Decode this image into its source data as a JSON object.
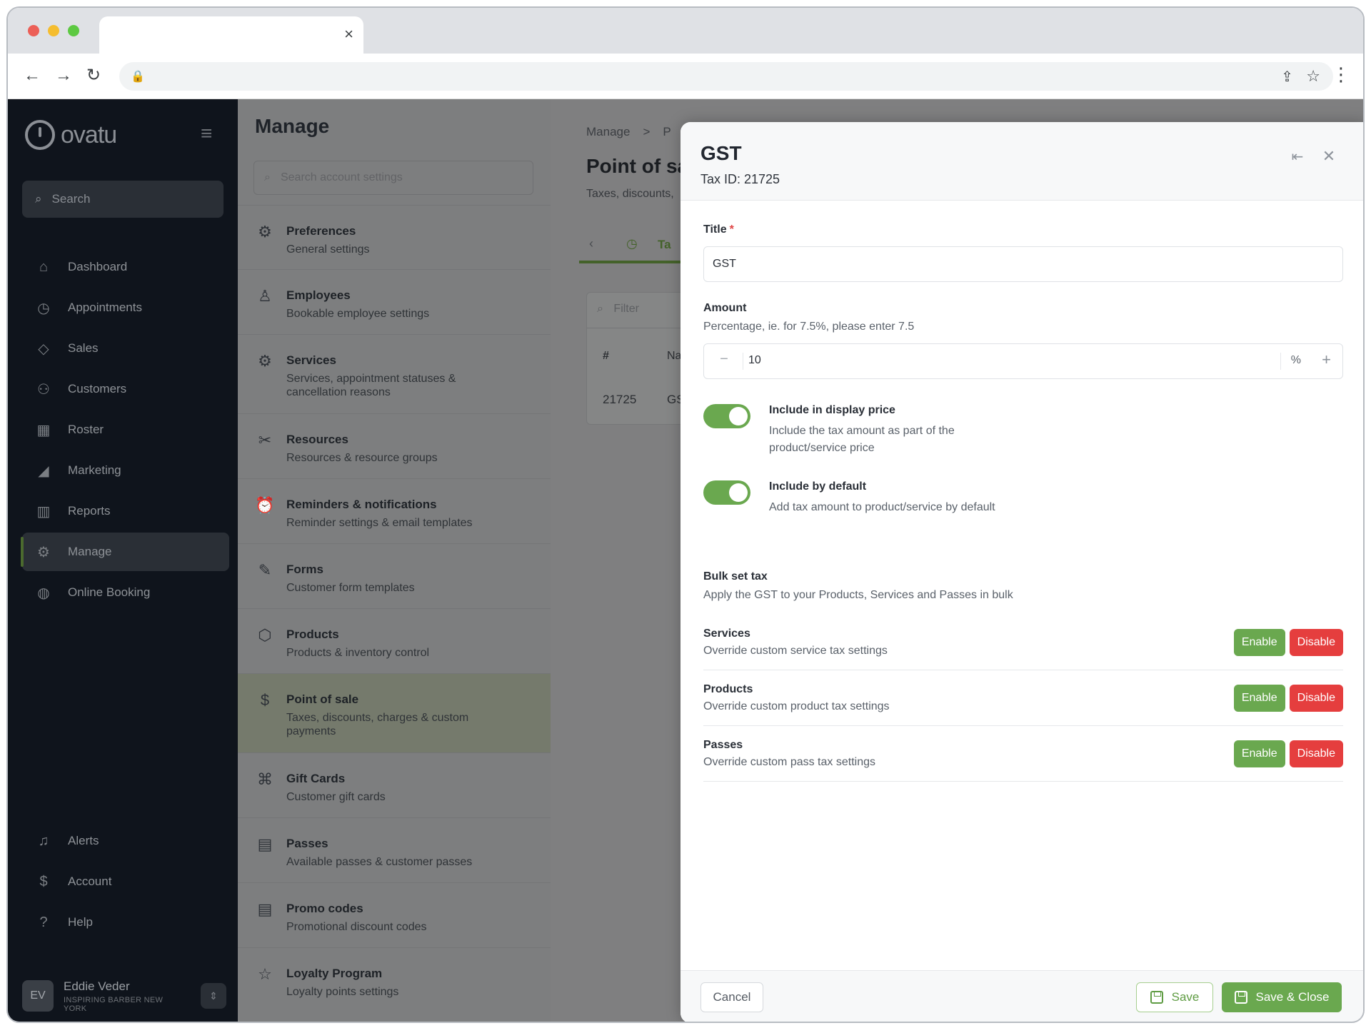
{
  "browser": {
    "tab_close": "×",
    "icons": {
      "back": "arrow-left-icon",
      "forward": "arrow-right-icon",
      "reload": "reload-icon",
      "lock": "lock-icon",
      "share": "share-icon",
      "star": "star-icon",
      "menu": "kebab-icon"
    }
  },
  "sidebar": {
    "logo_text": "ovatu",
    "search_label": "Search",
    "items": [
      {
        "label": "Dashboard",
        "icon": "home-icon"
      },
      {
        "label": "Appointments",
        "icon": "clock-icon"
      },
      {
        "label": "Sales",
        "icon": "tag-icon"
      },
      {
        "label": "Customers",
        "icon": "users-icon"
      },
      {
        "label": "Roster",
        "icon": "calendar-icon"
      },
      {
        "label": "Marketing",
        "icon": "megaphone-icon"
      },
      {
        "label": "Reports",
        "icon": "chart-icon"
      },
      {
        "label": "Manage",
        "icon": "gears-icon",
        "active": true
      },
      {
        "label": "Online Booking",
        "icon": "globe-icon"
      }
    ],
    "bottom_items": [
      {
        "label": "Alerts",
        "icon": "bell-icon"
      },
      {
        "label": "Account",
        "icon": "dollar-icon"
      },
      {
        "label": "Help",
        "icon": "question-icon"
      }
    ],
    "user": {
      "initials": "EV",
      "name": "Eddie Veder",
      "org": "INSPIRING BARBER NEW YORK"
    }
  },
  "manage": {
    "title": "Manage",
    "search_placeholder": "Search account settings",
    "items": [
      {
        "title": "Preferences",
        "desc": "General settings",
        "icon": "gear-icon"
      },
      {
        "title": "Employees",
        "desc": "Bookable employee settings",
        "icon": "person-icon"
      },
      {
        "title": "Services",
        "desc": "Services, appointment statuses & cancellation reasons",
        "icon": "gears-icon"
      },
      {
        "title": "Resources",
        "desc": "Resources & resource groups",
        "icon": "tools-icon"
      },
      {
        "title": "Reminders & notifications",
        "desc": "Reminder settings & email templates",
        "icon": "alarm-icon"
      },
      {
        "title": "Forms",
        "desc": "Customer form templates",
        "icon": "form-icon"
      },
      {
        "title": "Products",
        "desc": "Products & inventory control",
        "icon": "box-icon"
      },
      {
        "title": "Point of sale",
        "desc": "Taxes, discounts, charges & custom payments",
        "icon": "pos-icon",
        "active": true
      },
      {
        "title": "Gift Cards",
        "desc": "Customer gift cards",
        "icon": "gift-icon"
      },
      {
        "title": "Passes",
        "desc": "Available passes & customer passes",
        "icon": "ticket-icon"
      },
      {
        "title": "Promo codes",
        "desc": "Promotional discount codes",
        "icon": "promo-icon"
      },
      {
        "title": "Loyalty Program",
        "desc": "Loyalty points settings",
        "icon": "loyalty-icon"
      }
    ]
  },
  "under": {
    "breadcrumb": [
      "Manage",
      ">",
      "P"
    ],
    "title": "Point of sa",
    "subtitle": "Taxes, discounts,",
    "tab_label": "Ta",
    "filter_placeholder": "Filter",
    "col_num": "#",
    "col_name": "Na",
    "row_id": "21725",
    "row_name": "GS"
  },
  "modal": {
    "title": "GST",
    "tax_id": "Tax ID: 21725",
    "title_label": "Title",
    "required_mark": "*",
    "title_value": "GST",
    "amount_label": "Amount",
    "amount_help": "Percentage, ie. for 7.5%, please enter 7.5",
    "amount_value": "10",
    "amount_unit": "%",
    "display_price": {
      "title": "Include in display price",
      "desc": "Include the tax amount as part of the product/service price",
      "on": true
    },
    "by_default": {
      "title": "Include by default",
      "desc": "Add tax amount to product/service by default",
      "on": true
    },
    "bulk_title": "Bulk set tax",
    "bulk_desc": "Apply the GST to your Products, Services and Passes in bulk",
    "bulk_rows": [
      {
        "title": "Services",
        "desc": "Override custom service tax settings"
      },
      {
        "title": "Products",
        "desc": "Override custom product tax settings"
      },
      {
        "title": "Passes",
        "desc": "Override custom pass tax settings"
      }
    ],
    "enable_label": "Enable",
    "disable_label": "Disable",
    "cancel_label": "Cancel",
    "save_label": "Save",
    "save_close_label": "Save & Close",
    "colors": {
      "green": "#6aa84f",
      "red": "#e53e3e"
    }
  }
}
